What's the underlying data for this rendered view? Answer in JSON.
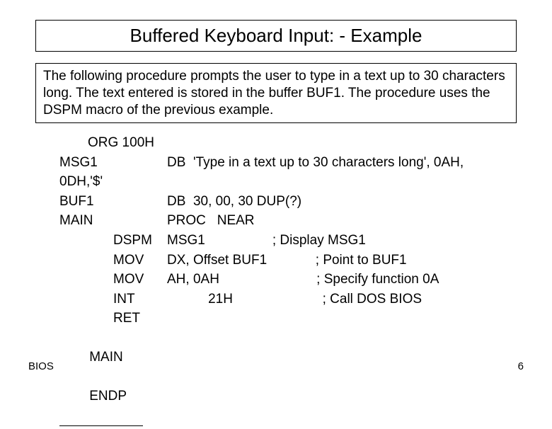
{
  "title": "Buffered Keyboard Input: - Example",
  "description": "The following procedure prompts the user to type in a text up to 30 characters long. The text entered is stored in the buffer BUF1. The procedure uses the DSPM macro of the previous example.",
  "code": {
    "org": "ORG 100H",
    "l1_label": "MSG1",
    "l1_rest": "DB  'Type in a text up to 30 characters long', 0AH,",
    "l2_label": "0DH,'$'",
    "l3_label": "BUF1",
    "l3_rest": "DB  30, 00, 30 DUP(?)",
    "l4_label": "MAIN",
    "l4_rest": "PROC   NEAR",
    "l5_opc": "DSPM",
    "l5_rest": "MSG1                  ; Display MSG1",
    "l6_opc": "MOV",
    "l6_rest": "DX, Offset BUF1             ; Point to BUF1",
    "l7_opc": "MOV",
    "l7_rest": "AH, 0AH                          ; Specify function 0A",
    "l8_opc": "INT",
    "l8_rest": "           21H                        ; Call DOS BIOS",
    "l9_opc": "RET",
    "l10_label": "MAIN",
    "l10_rest": "ENDP"
  },
  "footer_left": "BIOS",
  "footer_right": "6"
}
